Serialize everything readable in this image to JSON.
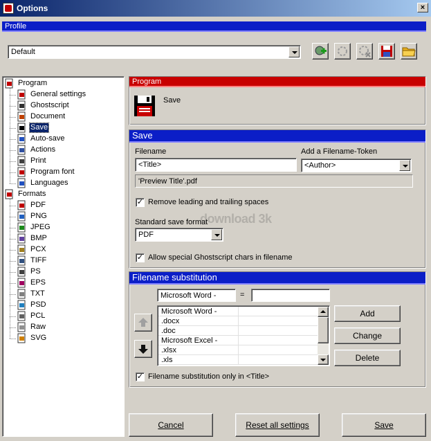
{
  "window": {
    "title": "Options",
    "close_label": "×"
  },
  "profile": {
    "header": "Profile",
    "selected": "Default"
  },
  "toolbar": {
    "icons": [
      "add-profile-icon",
      "rename-profile-icon",
      "delete-profile-icon",
      "save-profile-icon",
      "open-profile-icon"
    ]
  },
  "tree": {
    "program_label": "Program",
    "program_items": [
      "General settings",
      "Ghostscript",
      "Document",
      "Save",
      "Auto-save",
      "Actions",
      "Print",
      "Program font",
      "Languages"
    ],
    "formats_label": "Formats",
    "format_items": [
      "PDF",
      "PNG",
      "JPEG",
      "BMP",
      "PCX",
      "TIFF",
      "PS",
      "EPS",
      "TXT",
      "PSD",
      "PCL",
      "Raw",
      "SVG"
    ],
    "selected": "Save"
  },
  "program_panel": {
    "header": "Program",
    "section_name": "Save"
  },
  "save_panel": {
    "header": "Save",
    "filename_label": "Filename",
    "filename_value": "<Title>",
    "token_label": "Add a Filename-Token",
    "token_value": "<Author>",
    "preview": "'Preview Title'.pdf",
    "remove_spaces_label": "Remove leading and trailing spaces",
    "remove_spaces_checked": true,
    "format_label": "Standard save format",
    "format_value": "PDF",
    "allow_ghostscript_label": "Allow special Ghostscript chars in filename",
    "allow_ghostscript_checked": true
  },
  "substitution": {
    "header": "Filename substitution",
    "search_value": "Microsoft Word -",
    "equals": "=",
    "replace_value": "",
    "rows": [
      "Microsoft Word -",
      ".docx",
      ".doc",
      "Microsoft Excel -",
      ".xlsx",
      ".xls"
    ],
    "add_label": "Add",
    "change_label": "Change",
    "delete_label": "Delete",
    "only_title_label": "Filename substitution only in <Title>",
    "only_title_checked": true
  },
  "footer": {
    "cancel_label": "Cancel",
    "reset_label": "Reset all settings",
    "save_label": "Save"
  },
  "watermark": "download 3k",
  "colors": {
    "header_blue": "#0b1ec7",
    "header_red": "#c80000",
    "selection": "#0a246a"
  }
}
